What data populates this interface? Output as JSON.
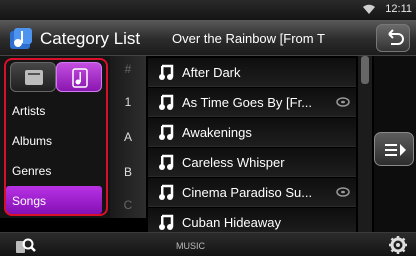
{
  "status": {
    "time": "12:11"
  },
  "header": {
    "title": "Category List",
    "now_playing": "Over the Rainbow [From T"
  },
  "sidebar": {
    "categories": [
      {
        "label": "Artists"
      },
      {
        "label": "Albums"
      },
      {
        "label": "Genres"
      },
      {
        "label": "Songs",
        "selected": true
      }
    ]
  },
  "alpha_index": [
    "#",
    "1",
    "A",
    "B",
    "C"
  ],
  "songs": [
    {
      "title": "After Dark"
    },
    {
      "title": "As Time Goes By [Fr...",
      "badge": "cd-icon"
    },
    {
      "title": "Awakenings"
    },
    {
      "title": "Careless Whisper"
    },
    {
      "title": "Cinema Paradiso Su...",
      "badge": "cd-icon"
    },
    {
      "title": "Cuban Hideaway"
    }
  ],
  "footer": {
    "source": "MUSIC"
  },
  "colors": {
    "accent": "#a020d0",
    "highlight_box": "#d8102a"
  }
}
